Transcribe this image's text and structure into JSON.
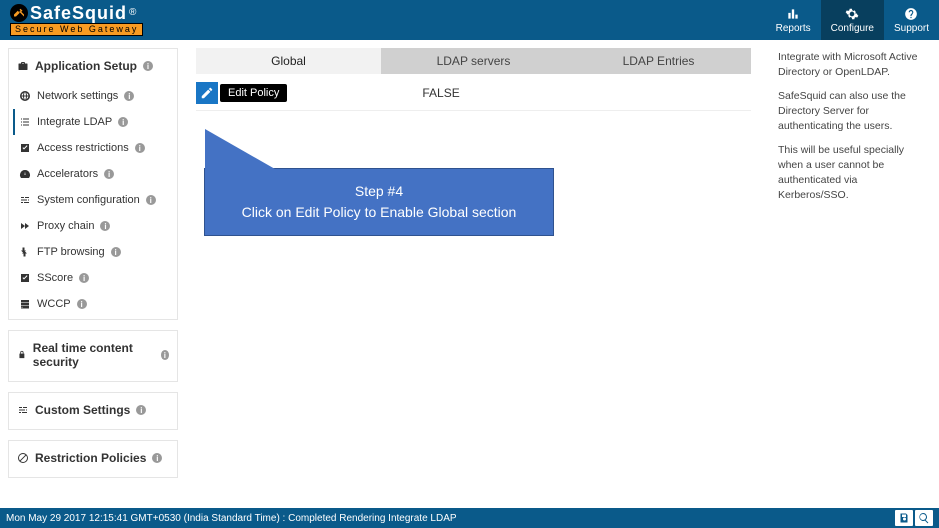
{
  "brand": {
    "name": "SafeSquid",
    "reg": "®",
    "tagline": "Secure Web Gateway"
  },
  "topnav": {
    "reports": "Reports",
    "configure": "Configure",
    "support": "Support"
  },
  "sidebar": {
    "section1": {
      "header": "Application Setup",
      "items": [
        "Network settings",
        "Integrate LDAP",
        "Access restrictions",
        "Accelerators",
        "System configuration",
        "Proxy chain",
        "FTP browsing",
        "SScore",
        "WCCP"
      ]
    },
    "section2": {
      "header": "Real time content security"
    },
    "section3": {
      "header": "Custom Settings"
    },
    "section4": {
      "header": "Restriction Policies"
    }
  },
  "tabs": {
    "global": "Global",
    "ldap_servers": "LDAP servers",
    "ldap_entries": "LDAP Entries"
  },
  "row": {
    "edit_tip": "Edit Policy",
    "value": "FALSE"
  },
  "callout": {
    "title": "Step #4",
    "body": "Click on Edit Policy to Enable Global section"
  },
  "help": {
    "p1": "Integrate with Microsoft Active Directory or OpenLDAP.",
    "p2": "SafeSquid can also use the Directory Server for authenticating the users.",
    "p3": "This will be useful specially when a user cannot be authenticated via Kerberos/SSO."
  },
  "status": {
    "text": "Mon May 29 2017 12:15:41 GMT+0530 (India Standard Time) : Completed Rendering Integrate LDAP"
  }
}
